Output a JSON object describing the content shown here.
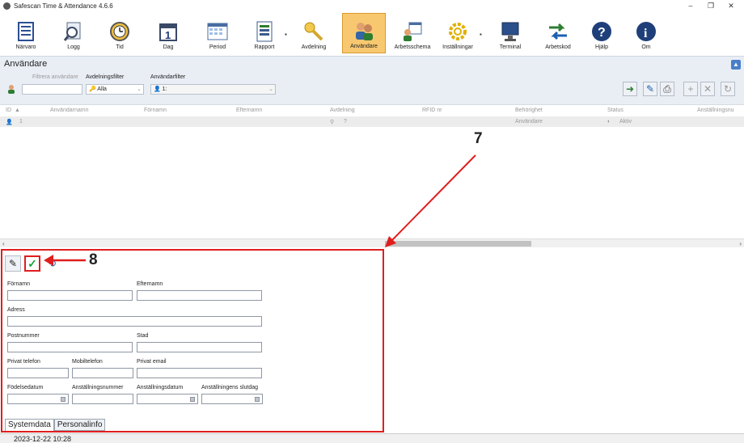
{
  "window": {
    "title": "Safescan Time & Attendance 4.6.6",
    "minimize": "–",
    "maximize": "❐",
    "close": "✕"
  },
  "toolbar": {
    "buttons": [
      {
        "label": "Närvaro",
        "icon": "list-icon"
      },
      {
        "label": "Logg",
        "icon": "search-icon"
      },
      {
        "label": "Tid",
        "icon": "clock-icon"
      },
      {
        "label": "Dag",
        "icon": "calendar-day-icon"
      },
      {
        "label": "Period",
        "icon": "calendar-period-icon"
      },
      {
        "label": "Rapport",
        "icon": "report-icon"
      },
      {
        "label": "Avdelning",
        "icon": "key-icon"
      },
      {
        "label": "Användare",
        "icon": "users-icon"
      },
      {
        "label": "Arbetsschema",
        "icon": "schedule-icon"
      },
      {
        "label": "Inställningar",
        "icon": "gear-icon"
      },
      {
        "label": "Terminal",
        "icon": "monitor-icon"
      },
      {
        "label": "Arbetskod",
        "icon": "arrows-icon"
      },
      {
        "label": "Hjälp",
        "icon": "help-icon"
      },
      {
        "label": "Om",
        "icon": "info-icon"
      }
    ],
    "active": "Användare"
  },
  "panel": {
    "title": "Användare",
    "filter_users_label": "Filtrera användare",
    "dept_filter_label": "Avdelningsfilter",
    "dept_filter_value": "Alla",
    "user_filter_label": "Användarfilter",
    "user_filter_value": "1:"
  },
  "grid": {
    "columns": [
      "ID",
      "Användarnamn",
      "Förnamn",
      "Efternamn",
      "Avdelning",
      "RFID nr",
      "Behörighet",
      "Status",
      "Anställningsnu"
    ],
    "sort_indicator": "▲",
    "rows": [
      {
        "id": "1",
        "dept": "?",
        "role": "Användare",
        "status": "Aktiv"
      }
    ]
  },
  "form": {
    "firstname_label": "Förnamn",
    "lastname_label": "Efternamn",
    "address_label": "Adress",
    "postcode_label": "Postnummer",
    "city_label": "Stad",
    "private_phone_label": "Privat telefon",
    "mobile_label": "Mobiltelefon",
    "private_email_label": "Privat email",
    "birthdate_label": "Födelsedatum",
    "employee_no_label": "Anställningsnummer",
    "employment_date_label": "Anställningsdatum",
    "employment_end_label": "Anställningens slutdag"
  },
  "tabs": [
    "Systemdata",
    "Personalinfo"
  ],
  "status": {
    "datetime": "2023-12-22 10:28"
  },
  "annotations": {
    "label7": "7",
    "label8": "8"
  },
  "colors": {
    "highlight": "#e01e1e",
    "active_tab": "#f8c870"
  }
}
